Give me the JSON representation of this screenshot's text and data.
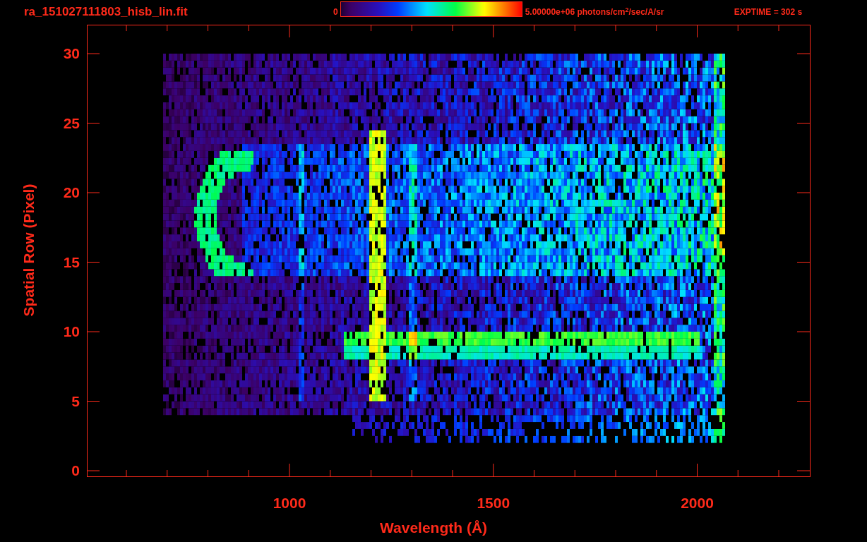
{
  "header": {
    "filename": "ra_151027111803_hisb_lin.fit",
    "colorbar_min": "0",
    "colorbar_max": "5.00000e+06 photons/cm$^{2}$/sec/A/sr",
    "exposure": "EXPTIME = 302 s"
  },
  "plot": {
    "ylabel": "Spatial Row (Pixel)",
    "xlabel": "Wavelength (Å)",
    "yticks": [
      "30",
      "25",
      "20",
      "15",
      "10",
      "5",
      "0"
    ],
    "xticks": [
      "1000",
      "1500",
      "2000"
    ]
  }
}
